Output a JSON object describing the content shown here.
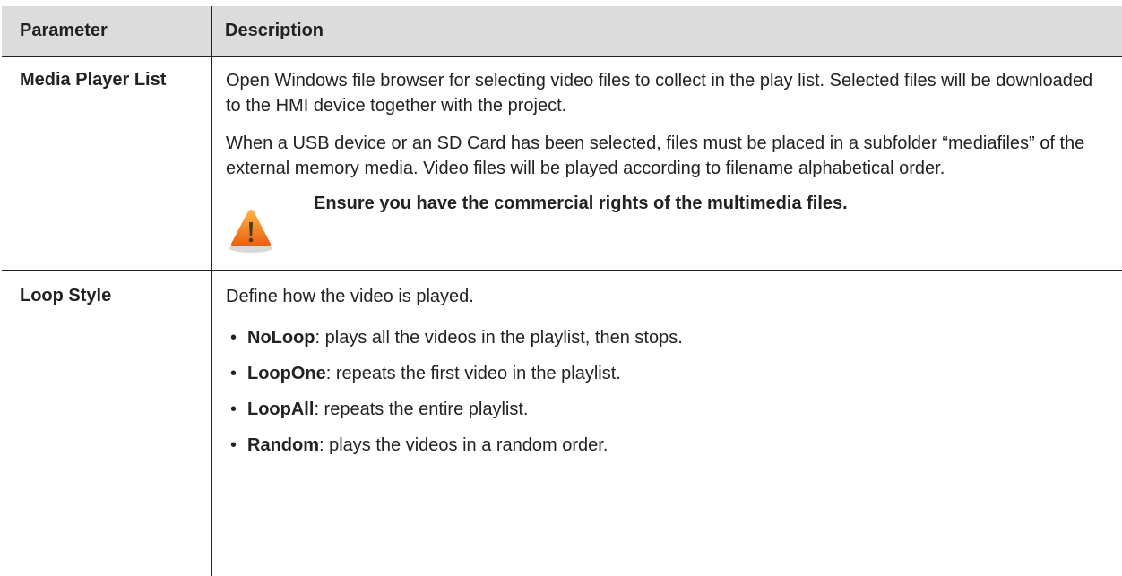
{
  "table": {
    "header": {
      "parameter": "Parameter",
      "description": "Description"
    },
    "rows": [
      {
        "parameter": "Media Player List",
        "paragraphs": [
          "Open Windows file browser for selecting video files to collect in the play list. Selected files will be downloaded to the HMI device together with the project.",
          "When a USB device or an SD Card has been selected, files must be placed in a subfolder “mediafiles” of the external memory media. Video files will be played according to filename alphabetical order."
        ],
        "note": {
          "icon": "warning-icon",
          "text": "Ensure you have the commercial rights of the multimedia files."
        }
      },
      {
        "parameter": "Loop Style",
        "intro": "Define how the video is played.",
        "options": [
          {
            "name": "NoLoop",
            "text": ": plays all the videos in the playlist, then stops."
          },
          {
            "name": "LoopOne",
            "text": ": repeats the first video in the playlist."
          },
          {
            "name": "LoopAll",
            "text": ": repeats the entire playlist."
          },
          {
            "name": "Random",
            "text": ": plays the videos in a random order."
          }
        ]
      }
    ]
  },
  "colors": {
    "header_bg": "#dcdcdc",
    "border": "#222222",
    "warning_orange": "#f07c1e"
  }
}
